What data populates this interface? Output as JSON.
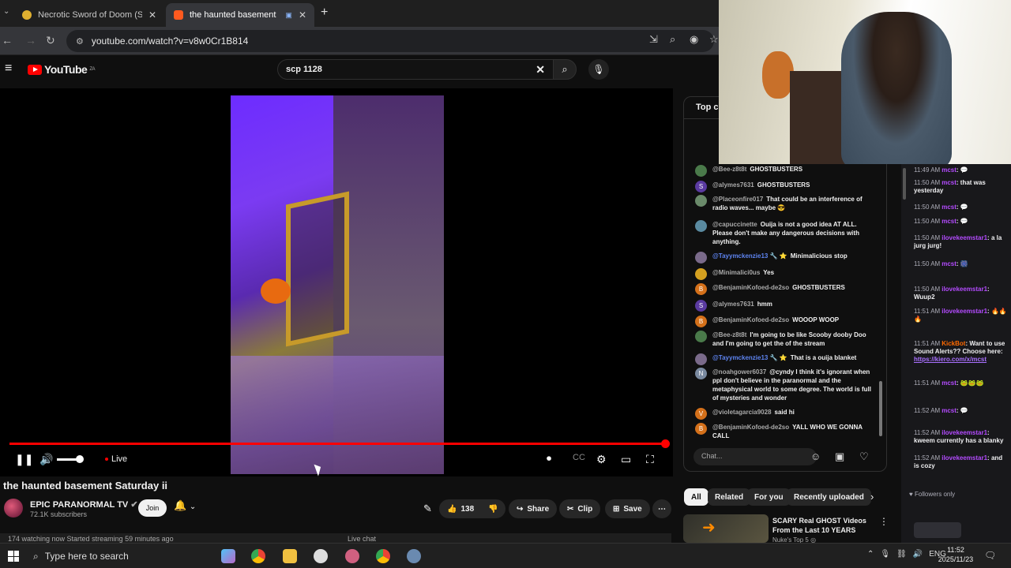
{
  "browser": {
    "tabs": [
      {
        "title": "Necrotic Sword of Doom (Swor",
        "active": false
      },
      {
        "title": "the haunted basement Satu",
        "active": true
      }
    ],
    "new_tab": "+",
    "url": "youtube.com/watch?v=v8w0Cr1B814"
  },
  "youtube": {
    "logo_text": "YouTube",
    "region": "ZA",
    "search_value": "scp 1128"
  },
  "video": {
    "live_label": "Live",
    "progress_percent": 100,
    "title": "the haunted basement Saturday ii",
    "channel": "EPIC PARANORMAL TV",
    "subscribers": "72.1K subscribers",
    "join_label": "Join",
    "likes": "138",
    "share_label": "Share",
    "clip_label": "Clip",
    "save_label": "Save",
    "watching_text": "174 watching now  Started streaming 59 minutes ago",
    "live_chat_label": "Live chat"
  },
  "live_chat": {
    "header": "Top ch",
    "input_placeholder": "Chat...",
    "messages": [
      {
        "author": "@Bee-z8t8t",
        "text": "GHOSTBUSTERS",
        "av": "#4a7a4a",
        "mod": false
      },
      {
        "author": "@alymes7631",
        "text": "GHOSTBUSTERS",
        "av": "#5a3aa0",
        "initial": "S",
        "mod": false
      },
      {
        "author": "@Placeonfire017",
        "text": "That could be an interference of radio waves... maybe 😎",
        "av": "#6a8a6a",
        "mod": false
      },
      {
        "author": "@capuccinette",
        "text": "Ouija is not a good idea AT ALL. Please don't make any dangerous decisions with anything.",
        "av": "#5a8aa0",
        "mod": false
      },
      {
        "author": "@Tayymckenzie13 🔧 ⭐",
        "text": "Minimalicious stop",
        "av": "#7a6a8a",
        "mod": true
      },
      {
        "author": "@Minimalici0us",
        "text": "Yes",
        "av": "#d4a020",
        "mod": false
      },
      {
        "author": "@BenjaminKofoed-de2so",
        "text": "GHOSTBUSTERS",
        "av": "#d4701a",
        "initial": "B",
        "mod": false
      },
      {
        "author": "@alymes7631",
        "text": "hmm",
        "av": "#5a3aa0",
        "initial": "S",
        "mod": false
      },
      {
        "author": "@BenjaminKofoed-de2so",
        "text": "WOOOP WOOP",
        "av": "#d4701a",
        "initial": "B",
        "mod": false
      },
      {
        "author": "@Bee-z8t8t",
        "text": "I'm going to be like Scooby dooby Doo and I'm going to get the of the stream",
        "av": "#4a7a4a",
        "mod": false
      },
      {
        "author": "@Tayymckenzie13 🔧 ⭐",
        "text": "That is a ouija blanket",
        "av": "#7a6a8a",
        "mod": true
      },
      {
        "author": "@noahgower6037",
        "text": "@cyndy I think it's ignorant when ppl don't believe in the paranormal and the metaphysical world to some degree. The world is full of mysteries and wonder",
        "av": "#7a8aa0",
        "initial": "N",
        "mod": false
      },
      {
        "author": "@violetagarcia9028",
        "text": "said hi",
        "av": "#d4701a",
        "initial": "V",
        "mod": false
      },
      {
        "author": "@BenjaminKofoed-de2so",
        "text": "YALL WHO WE GONNA CALL",
        "av": "#d4701a",
        "initial": "B",
        "mod": false
      }
    ]
  },
  "chips": [
    "All",
    "Related",
    "For you",
    "Recently uploaded"
  ],
  "recommendation": {
    "title": "SCARY Real GHOST Videos From the Last 10 YEARS",
    "channel": "Nuke's Top 5 ◎"
  },
  "side_chat": {
    "messages": [
      {
        "time": "11:49 AM",
        "user": "mcst",
        "text": "💬",
        "cls": "u1"
      },
      {
        "time": "11:50 AM",
        "user": "mcst",
        "text": "that was yesterday",
        "cls": "u1"
      },
      {
        "time": "11:50 AM",
        "user": "mcst",
        "text": "💬",
        "cls": "u1"
      },
      {
        "time": "11:50 AM",
        "user": "mcst",
        "text": "💬",
        "cls": "u1"
      },
      {
        "time": "11:50 AM",
        "user": "ilovekeemstar1",
        "text": "a la jurg jurg!",
        "cls": "u1"
      },
      {
        "time": "11:50 AM",
        "user": "mcst",
        "text": "🎆",
        "cls": "u1"
      },
      {
        "time": "11:50 AM",
        "user": "ilovekeemstar1",
        "text": "Wuup2",
        "cls": "u1"
      },
      {
        "time": "11:51 AM",
        "user": "ilovekeemstar1",
        "text": "🔥🔥🔥",
        "cls": "u1"
      },
      {
        "time": "11:51 AM",
        "user": "KickBot",
        "text": "Want to use Sound Alerts?? Choose here:",
        "cls": "u3",
        "link": "https://kiero.com/x/mcst"
      },
      {
        "time": "11:51 AM",
        "user": "mcst",
        "text": "🐸🐸🐸",
        "cls": "u1"
      },
      {
        "time": "11:52 AM",
        "user": "mcst",
        "text": "💬",
        "cls": "u1"
      },
      {
        "time": "11:52 AM",
        "user": "ilovekeemstar1",
        "text": "kweem currently has a blanky",
        "cls": "u1"
      },
      {
        "time": "11:52 AM",
        "user": "ilovekeemstar1",
        "text": "and is cozy",
        "cls": "u1"
      }
    ],
    "followers_label": "Followers only"
  },
  "taskbar": {
    "search_placeholder": "Type here to search",
    "lang": "ENG",
    "time": "11:52",
    "date": "2025/11/23"
  }
}
